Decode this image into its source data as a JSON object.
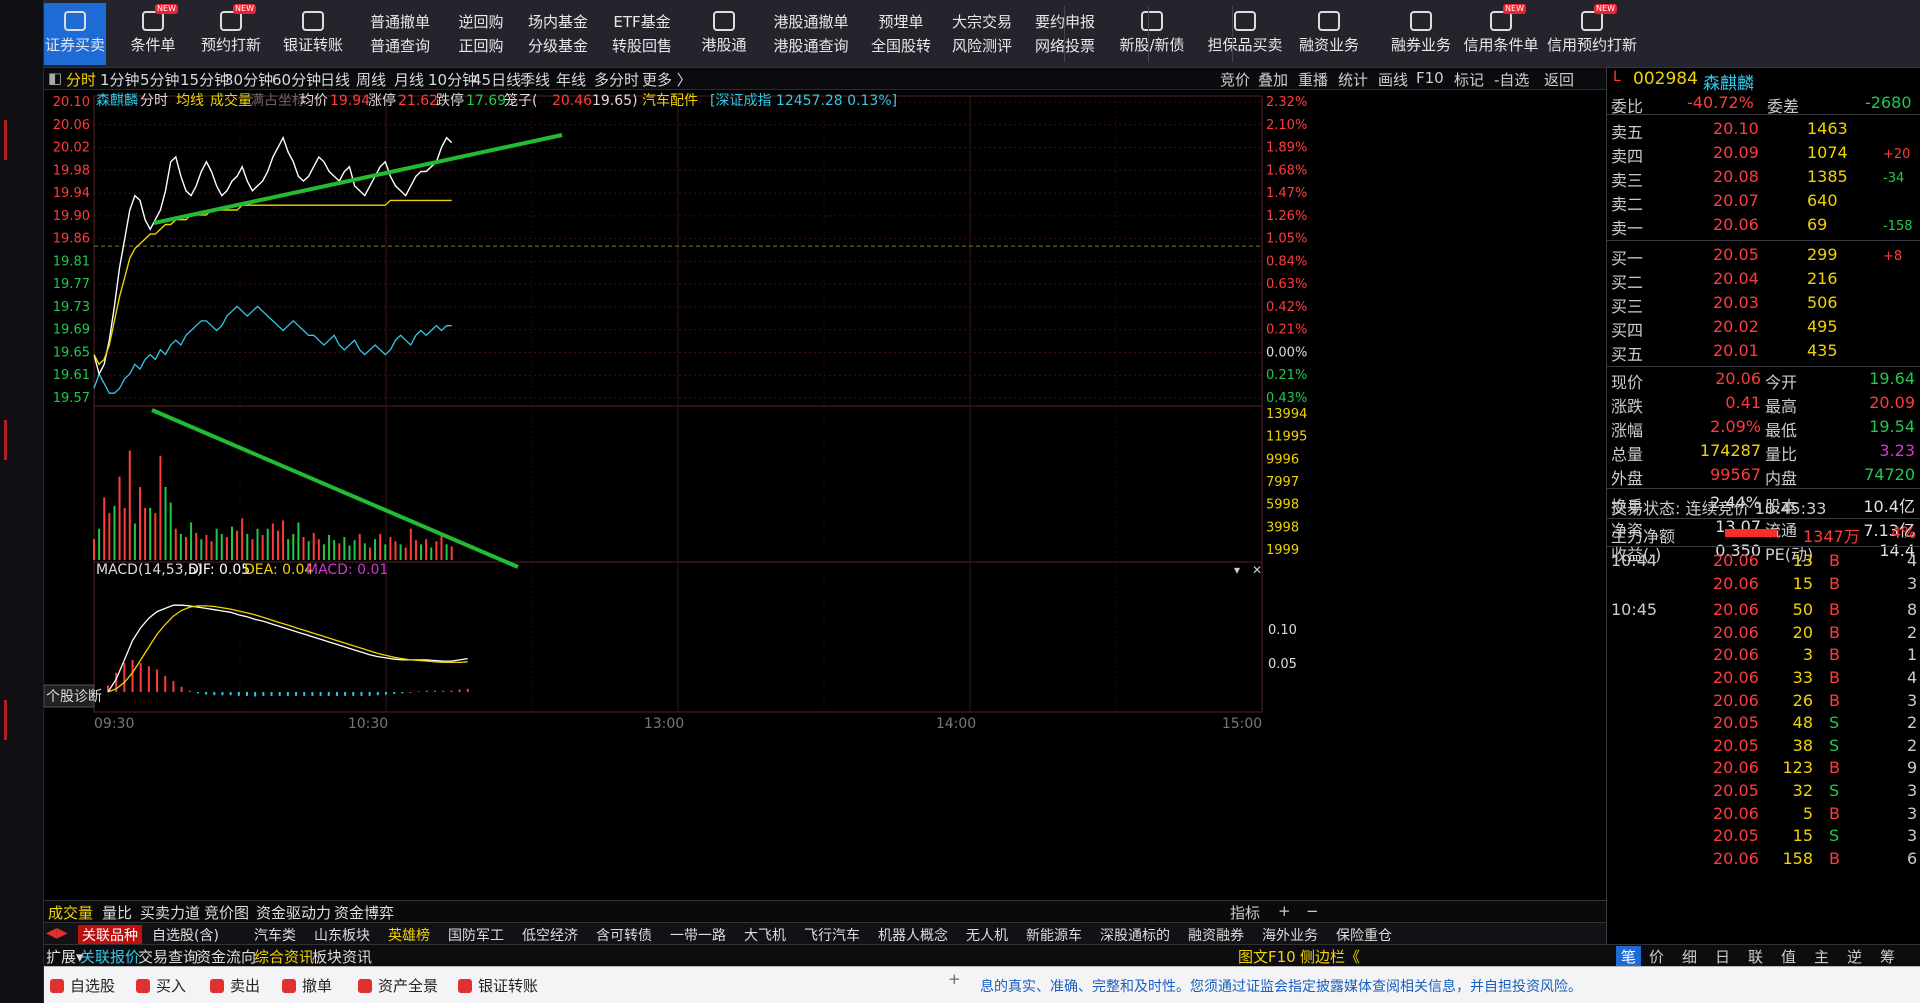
{
  "toolbar": {
    "buttons": [
      {
        "label": "证券买卖",
        "type": "icon",
        "active": true,
        "icon": "trade-icon"
      },
      {
        "label": "条件单",
        "type": "icon",
        "new": true,
        "icon": "condition-icon"
      },
      {
        "label": "预约打新",
        "type": "icon",
        "new": true,
        "icon": "ipo-icon"
      },
      {
        "label": "银证转账",
        "type": "icon",
        "icon": "transfer-icon"
      },
      {
        "top": "普通撤单",
        "bottom": "普通查询",
        "type": "pair"
      },
      {
        "top": "逆回购",
        "bottom": "正回购",
        "type": "pair"
      },
      {
        "top": "场内基金",
        "bottom": "分级基金",
        "type": "pair"
      },
      {
        "top": "ETF基金",
        "bottom": "转股回售",
        "type": "pair"
      },
      {
        "label": "港股通",
        "type": "icon",
        "icon": "hk-icon"
      },
      {
        "top": "港股通撤单",
        "bottom": "港股通查询",
        "type": "pair"
      },
      {
        "top": "预埋单",
        "bottom": "全国股转",
        "type": "pair"
      },
      {
        "top": "大宗交易",
        "bottom": "风险测评",
        "type": "pair"
      },
      {
        "top": "要约申报",
        "bottom": "网络投票",
        "type": "pair"
      },
      {
        "label": "新股/新债",
        "type": "icon",
        "icon": "new-stock-icon"
      },
      {
        "label": "担保品买卖",
        "type": "icon",
        "icon": "shield-icon"
      },
      {
        "label": "融资业务",
        "type": "icon",
        "icon": "yen-icon"
      },
      {
        "label": "融券业务",
        "type": "icon",
        "icon": "bow-icon"
      },
      {
        "label": "信用条件单",
        "type": "icon",
        "new": true,
        "icon": "credit-condition-icon"
      },
      {
        "label": "信用预约打新",
        "type": "icon",
        "new": true,
        "icon": "credit-ipo-icon"
      }
    ]
  },
  "periods": [
    "分时",
    "1分钟",
    "5分钟",
    "15分钟",
    "30分钟",
    "60分钟",
    "日线",
    "周线",
    "月线",
    "10分钟",
    "45日线",
    "季线",
    "年线",
    "多分时",
    "更多 〉"
  ],
  "period_right": [
    "竞价",
    "叠加",
    "重播",
    "统计",
    "画线",
    "F10",
    "标记",
    "-自选",
    "返回"
  ],
  "info": {
    "name": "森麒麟",
    "mode": "分时",
    "avg": "均线",
    "vol": "成交量",
    "coord": "满占坐标",
    "avg_label": "均价",
    "avg_val": "19.94",
    "zt_label": "涨停",
    "zt_val": "21.62",
    "dt_label": "跌停",
    "dt_val": "17.69",
    "cage_label": "笼子(",
    "cage_a": "20.46",
    "cage_b": "19.65)",
    "sector": "汽车配件",
    "index": "[深证成指 12457.28 0.13%]"
  },
  "macd": {
    "label": "MACD(14,53,5)",
    "dif": "DIF: 0.05",
    "dea": "DEA: 0.04",
    "macd": "MACD: 0.01"
  },
  "diag_button": "个股诊断",
  "colors": {
    "up": "#ff3b3b",
    "down": "#1fc94c",
    "price": "#ffffff",
    "avg": "#f0d300",
    "trend": "#22bb33",
    "grid": "#3a1010"
  },
  "chart_data": {
    "type": "line",
    "title": "森麒麟 分时",
    "ylim": [
      19.53,
      20.14
    ],
    "price_ticks": [
      "20.10",
      "20.06",
      "20.02",
      "19.98",
      "19.94",
      "19.90",
      "19.86",
      "19.81",
      "19.77",
      "19.73",
      "19.69",
      "19.65",
      "19.61",
      "19.57"
    ],
    "pct_ticks": [
      "2.32%",
      "2.10%",
      "1.89%",
      "1.68%",
      "1.47%",
      "1.26%",
      "1.05%",
      "0.84%",
      "0.63%",
      "0.42%",
      "0.21%",
      "0.00%",
      "0.21%",
      "0.43%"
    ],
    "vol_ticks": [
      "13994",
      "11995",
      "9996",
      "7997",
      "5998",
      "3998",
      "1999"
    ],
    "macd_ticks": [
      "0.10",
      "0.05"
    ],
    "time_ticks": [
      "09:30",
      "10:30",
      "13:00",
      "14:00",
      "15:00"
    ],
    "series": [
      {
        "values": [
          19.62,
          19.58,
          19.6,
          19.65,
          19.72,
          19.8,
          19.86,
          19.92,
          19.95,
          19.94,
          19.9,
          19.88,
          19.9,
          19.92,
          19.96,
          20.02,
          20.03,
          19.99,
          19.96,
          19.95,
          19.97,
          20.0,
          20.02,
          20.0,
          19.97,
          19.95,
          19.96,
          19.98,
          19.99,
          20.01,
          19.98,
          19.96,
          19.97,
          19.98,
          20.0,
          20.03,
          20.05,
          20.07,
          20.04,
          20.02,
          19.99,
          19.98,
          19.99,
          20.01,
          20.03,
          20.02,
          20.0,
          19.99,
          19.98,
          20.0,
          20.01,
          19.97,
          19.96,
          19.95,
          19.97,
          19.99,
          20.01,
          20.02,
          19.99,
          19.97,
          19.96,
          19.95,
          19.97,
          19.99,
          20.0,
          20.0,
          20.01,
          20.02,
          20.05,
          20.07,
          20.06
        ]
      },
      {
        "values": [
          19.62,
          19.6,
          19.61,
          19.64,
          19.69,
          19.74,
          19.78,
          19.82,
          19.84,
          19.85,
          19.86,
          19.87,
          19.87,
          19.88,
          19.89,
          19.89,
          19.9,
          19.9,
          19.9,
          19.91,
          19.91,
          19.91,
          19.91,
          19.92,
          19.92,
          19.92,
          19.92,
          19.92,
          19.92,
          19.93,
          19.93,
          19.93,
          19.93,
          19.93,
          19.93,
          19.93,
          19.93,
          19.93,
          19.93,
          19.93,
          19.93,
          19.93,
          19.93,
          19.93,
          19.93,
          19.93,
          19.93,
          19.93,
          19.93,
          19.93,
          19.93,
          19.93,
          19.93,
          19.93,
          19.93,
          19.93,
          19.93,
          19.93,
          19.94,
          19.94,
          19.94,
          19.94,
          19.94,
          19.94,
          19.94,
          19.94,
          19.94,
          19.94,
          19.94,
          19.94,
          19.94
        ]
      }
    ],
    "volume": [
      {
        "v": 2000,
        "up": true
      },
      {
        "v": 3000,
        "up": false
      },
      {
        "v": 6000,
        "up": true
      },
      {
        "v": 4500,
        "up": true
      },
      {
        "v": 5200,
        "up": false
      },
      {
        "v": 8000,
        "up": true
      },
      {
        "v": 5000,
        "up": true
      },
      {
        "v": 10500,
        "up": true
      },
      {
        "v": 3500,
        "up": false
      },
      {
        "v": 7000,
        "up": true
      },
      {
        "v": 5000,
        "up": true
      },
      {
        "v": 5000,
        "up": false
      },
      {
        "v": 4500,
        "up": true
      },
      {
        "v": 10000,
        "up": true
      },
      {
        "v": 7000,
        "up": false
      },
      {
        "v": 5500,
        "up": false
      },
      {
        "v": 3000,
        "up": true
      },
      {
        "v": 2500,
        "up": false
      },
      {
        "v": 2200,
        "up": true
      },
      {
        "v": 3600,
        "up": false
      },
      {
        "v": 2600,
        "up": true
      },
      {
        "v": 2000,
        "up": false
      },
      {
        "v": 2400,
        "up": true
      },
      {
        "v": 1800,
        "up": true
      },
      {
        "v": 3000,
        "up": false
      },
      {
        "v": 2500,
        "up": false
      },
      {
        "v": 2200,
        "up": true
      },
      {
        "v": 3200,
        "up": false
      },
      {
        "v": 2800,
        "up": true
      },
      {
        "v": 4000,
        "up": true
      },
      {
        "v": 2500,
        "up": false
      },
      {
        "v": 2000,
        "up": true
      },
      {
        "v": 3000,
        "up": false
      },
      {
        "v": 2400,
        "up": true
      },
      {
        "v": 3000,
        "up": false
      },
      {
        "v": 3500,
        "up": true
      },
      {
        "v": 2800,
        "up": true
      },
      {
        "v": 3800,
        "up": true
      },
      {
        "v": 2000,
        "up": false
      },
      {
        "v": 2500,
        "up": false
      },
      {
        "v": 3600,
        "up": false
      },
      {
        "v": 2200,
        "up": true
      },
      {
        "v": 1800,
        "up": false
      },
      {
        "v": 2600,
        "up": true
      },
      {
        "v": 2000,
        "up": true
      },
      {
        "v": 1500,
        "up": false
      },
      {
        "v": 2400,
        "up": false
      },
      {
        "v": 1900,
        "up": false
      },
      {
        "v": 1600,
        "up": true
      },
      {
        "v": 2200,
        "up": false
      },
      {
        "v": 1400,
        "up": false
      },
      {
        "v": 1900,
        "up": false
      },
      {
        "v": 2500,
        "up": true
      },
      {
        "v": 1600,
        "up": false
      },
      {
        "v": 1200,
        "up": true
      },
      {
        "v": 2000,
        "up": false
      },
      {
        "v": 2500,
        "up": true
      },
      {
        "v": 1500,
        "up": false
      },
      {
        "v": 2200,
        "up": true
      },
      {
        "v": 1800,
        "up": true
      },
      {
        "v": 1500,
        "up": false
      },
      {
        "v": 1200,
        "up": true
      },
      {
        "v": 3000,
        "up": true
      },
      {
        "v": 1900,
        "up": true
      },
      {
        "v": 1500,
        "up": false
      },
      {
        "v": 2000,
        "up": true
      },
      {
        "v": 1200,
        "up": false
      },
      {
        "v": 1800,
        "up": true
      },
      {
        "v": 2300,
        "up": true
      },
      {
        "v": 1500,
        "up": false
      },
      {
        "v": 1300,
        "up": true
      }
    ],
    "ratio_line": [
      19.55,
      19.58,
      19.56,
      19.54,
      19.54,
      19.55,
      19.57,
      19.58,
      19.6,
      19.59,
      19.61,
      19.62,
      19.61,
      19.63,
      19.62,
      19.64,
      19.65,
      19.64,
      19.66,
      19.67,
      19.68,
      19.69,
      19.69,
      19.68,
      19.67,
      19.68,
      19.7,
      19.71,
      19.72,
      19.71,
      19.7,
      19.71,
      19.72,
      19.71,
      19.7,
      19.69,
      19.68,
      19.67,
      19.68,
      19.69,
      19.68,
      19.67,
      19.66,
      19.66,
      19.65,
      19.64,
      19.65,
      19.66,
      19.64,
      19.63,
      19.64,
      19.65,
      19.63,
      19.62,
      19.63,
      19.64,
      19.63,
      19.62,
      19.63,
      19.65,
      19.66,
      19.65,
      19.64,
      19.66,
      19.67,
      19.66,
      19.67,
      19.68,
      19.67,
      19.68,
      19.68
    ],
    "macd_dif": [
      0.0,
      0.02,
      0.05,
      0.08,
      0.1,
      0.115,
      0.125,
      0.13,
      0.135,
      0.135,
      0.134,
      0.132,
      0.13,
      0.128,
      0.126,
      0.124,
      0.12,
      0.117,
      0.113,
      0.11,
      0.106,
      0.102,
      0.098,
      0.094,
      0.09,
      0.086,
      0.082,
      0.078,
      0.074,
      0.07,
      0.066,
      0.062,
      0.058,
      0.055,
      0.053,
      0.051,
      0.05,
      0.05,
      0.05,
      0.05,
      0.049,
      0.048,
      0.048,
      0.05,
      0.052
    ],
    "macd_dea": [
      0.0,
      0.005,
      0.015,
      0.03,
      0.05,
      0.07,
      0.09,
      0.105,
      0.118,
      0.127,
      0.132,
      0.134,
      0.134,
      0.133,
      0.131,
      0.129,
      0.126,
      0.123,
      0.12,
      0.116,
      0.112,
      0.108,
      0.104,
      0.1,
      0.096,
      0.092,
      0.088,
      0.084,
      0.08,
      0.076,
      0.072,
      0.068,
      0.064,
      0.06,
      0.057,
      0.054,
      0.052,
      0.05,
      0.049,
      0.048,
      0.047,
      0.046,
      0.046,
      0.046,
      0.047
    ],
    "macd_bar": [
      0.01,
      0.03,
      0.045,
      0.05,
      0.045,
      0.04,
      0.035,
      0.025,
      0.017,
      0.008,
      0.002,
      -0.002,
      -0.004,
      -0.005,
      -0.005,
      -0.005,
      -0.006,
      -0.006,
      -0.007,
      -0.006,
      -0.006,
      -0.006,
      -0.006,
      -0.006,
      -0.006,
      -0.006,
      -0.006,
      -0.006,
      -0.006,
      -0.006,
      -0.006,
      -0.006,
      -0.006,
      -0.005,
      -0.004,
      -0.003,
      -0.002,
      0.0,
      0.001,
      0.002,
      0.002,
      0.002,
      0.002,
      0.004,
      0.005
    ]
  },
  "quote": {
    "code": "002984",
    "name": "森麒麟",
    "weibi_label": "委比",
    "weibi": "-40.72%",
    "weicha_label": "委差",
    "weicha": "-2680",
    "asks": [
      {
        "l": "卖五",
        "p": "20.10",
        "v": "1463",
        "c": ""
      },
      {
        "l": "卖四",
        "p": "20.09",
        "v": "1074",
        "c": "+20"
      },
      {
        "l": "卖三",
        "p": "20.08",
        "v": "1385",
        "c": "-34"
      },
      {
        "l": "卖二",
        "p": "20.07",
        "v": "640",
        "c": ""
      },
      {
        "l": "卖一",
        "p": "20.06",
        "v": "69",
        "c": "-158"
      }
    ],
    "bids": [
      {
        "l": "买一",
        "p": "20.05",
        "v": "299",
        "c": "+8"
      },
      {
        "l": "买二",
        "p": "20.04",
        "v": "216",
        "c": ""
      },
      {
        "l": "买三",
        "p": "20.03",
        "v": "506",
        "c": ""
      },
      {
        "l": "买四",
        "p": "20.02",
        "v": "495",
        "c": ""
      },
      {
        "l": "买五",
        "p": "20.01",
        "v": "435",
        "c": ""
      }
    ],
    "stats": [
      {
        "a": "现价",
        "av": "20.06",
        "ac": "red",
        "b": "今开",
        "bv": "19.64",
        "bc": "green"
      },
      {
        "a": "涨跌",
        "av": "0.41",
        "ac": "red",
        "b": "最高",
        "bv": "20.09",
        "bc": "red"
      },
      {
        "a": "涨幅",
        "av": "2.09%",
        "ac": "red",
        "b": "最低",
        "bv": "19.54",
        "bc": "green"
      },
      {
        "a": "总量",
        "av": "174287",
        "ac": "yel",
        "b": "量比",
        "bv": "3.23",
        "bc": "mag"
      },
      {
        "a": "外盘",
        "av": "99567",
        "ac": "red",
        "b": "内盘",
        "bv": "74720",
        "bc": "green"
      },
      {
        "a": "换手",
        "av": "2.44%",
        "ac": "wht",
        "b": "股本",
        "bv": "10.4亿",
        "bc": "wht"
      },
      {
        "a": "净资",
        "av": "13.07",
        "ac": "wht",
        "b": "流通",
        "bv": "7.13亿",
        "bc": "wht"
      },
      {
        "a": "收益(-)",
        "av": "0.350",
        "ac": "wht",
        "b": "PE(动)",
        "bv": "14.4",
        "bc": "wht"
      }
    ],
    "state": "交易状态: 连续竞价 10:45:33",
    "flow_label": "主力净额",
    "flow_val": "1347万",
    "flow_pct": "4%",
    "ticks": [
      {
        "t": "10:44",
        "p": "20.06",
        "v": "13",
        "s": "B",
        "n": "4"
      },
      {
        "t": "",
        "p": "20.06",
        "v": "15",
        "s": "B",
        "n": "3"
      },
      {
        "t": "10:45",
        "p": "20.06",
        "v": "50",
        "s": "B",
        "n": "8"
      },
      {
        "t": "",
        "p": "20.06",
        "v": "20",
        "s": "B",
        "n": "2"
      },
      {
        "t": "",
        "p": "20.06",
        "v": "3",
        "s": "B",
        "n": "1"
      },
      {
        "t": "",
        "p": "20.06",
        "v": "33",
        "s": "B",
        "n": "4"
      },
      {
        "t": "",
        "p": "20.06",
        "v": "26",
        "s": "B",
        "n": "3"
      },
      {
        "t": "",
        "p": "20.05",
        "v": "48",
        "s": "S",
        "n": "2"
      },
      {
        "t": "",
        "p": "20.05",
        "v": "38",
        "s": "S",
        "n": "2"
      },
      {
        "t": "",
        "p": "20.06",
        "v": "123",
        "s": "B",
        "n": "9"
      },
      {
        "t": "",
        "p": "20.05",
        "v": "32",
        "s": "S",
        "n": "3"
      },
      {
        "t": "",
        "p": "20.06",
        "v": "5",
        "s": "B",
        "n": "3"
      },
      {
        "t": "",
        "p": "20.05",
        "v": "15",
        "s": "S",
        "n": "3"
      },
      {
        "t": "",
        "p": "20.06",
        "v": "158",
        "s": "B",
        "n": "6"
      }
    ]
  },
  "sectabs": [
    "成交量",
    "量比",
    "买卖力道",
    "竞价图",
    "资金驱动力",
    "资金博弈"
  ],
  "sectabs_right": [
    "指标",
    "+",
    "−"
  ],
  "bottabs": [
    "关联品种",
    "自选股(含)",
    "汽车类",
    "山东板块",
    "英雄榜",
    "国防军工",
    "低空经济",
    "含可转债",
    "一带一路",
    "大飞机",
    "飞行汽车",
    "机器人概念",
    "无人机",
    "新能源车",
    "深股通标的",
    "融资融券",
    "海外业务",
    "保险重仓"
  ],
  "tabs3": [
    "扩展▾",
    "关联报价",
    "交易查询",
    "资金流向",
    "综合资讯",
    "板块资讯"
  ],
  "tabs3_right": [
    "图文F10",
    "侧边栏《"
  ],
  "rtabs": [
    "笔",
    "价",
    "细",
    "日",
    "联",
    "值",
    "主",
    "逆",
    "筹"
  ],
  "status": {
    "items": [
      "自选股",
      "买入",
      "卖出",
      "撤单",
      "资产全景",
      "银证转账"
    ],
    "notice": "息的真实、准确、完整和及时性。您须通过证监会指定披露媒体查阅相关信息，并自担投资风险。"
  }
}
